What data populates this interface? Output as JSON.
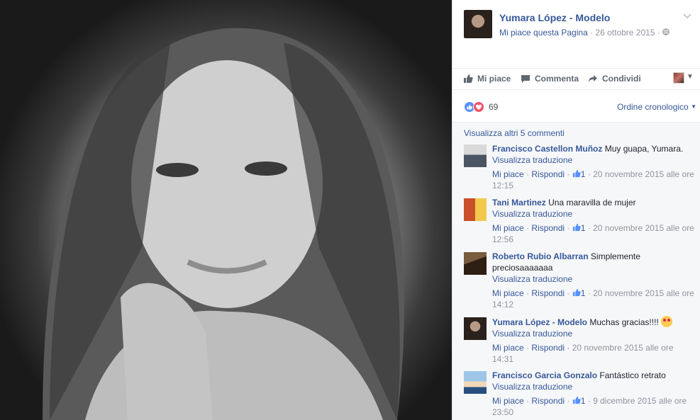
{
  "post": {
    "page_name": "Yumara López - Modelo",
    "like_page": "Mi piace questa Pagina",
    "date": "26 ottobre 2015"
  },
  "actions": {
    "like": "Mi piace",
    "comment": "Commenta",
    "share": "Condividi"
  },
  "reactions": {
    "count": "69",
    "sort": "Ordine cronologico"
  },
  "comments": {
    "more": "Visualizza altri 5 commenti",
    "translate_label": "Visualizza traduzione",
    "like_label": "Mi piace",
    "reply_label": "Rispondi",
    "items": [
      {
        "author": "Francisco Castellon Muñoz",
        "text": "Muy guapa, Yumara.",
        "likes": "1",
        "time": "20 novembre 2015 alle ore 12:15"
      },
      {
        "author": "Tani Martinez",
        "text": "Una maravilla de mujer",
        "likes": "1",
        "time": "20 novembre 2015 alle ore 12:56"
      },
      {
        "author": "Roberto Rubio Albarran",
        "text": "Simplemente preciosaaaaaaa",
        "likes": "1",
        "time": "20 novembre 2015 alle ore 14:12"
      },
      {
        "author": "Yumara López - Modelo",
        "text": "Muchas gracias!!!!",
        "likes": "",
        "time": "20 novembre 2015 alle ore 14:31"
      },
      {
        "author": "Francisco Garcia Gonzalo",
        "text": "Fantástico retrato",
        "likes": "1",
        "time": "9 dicembre 2015 alle ore 23:50"
      }
    ]
  }
}
